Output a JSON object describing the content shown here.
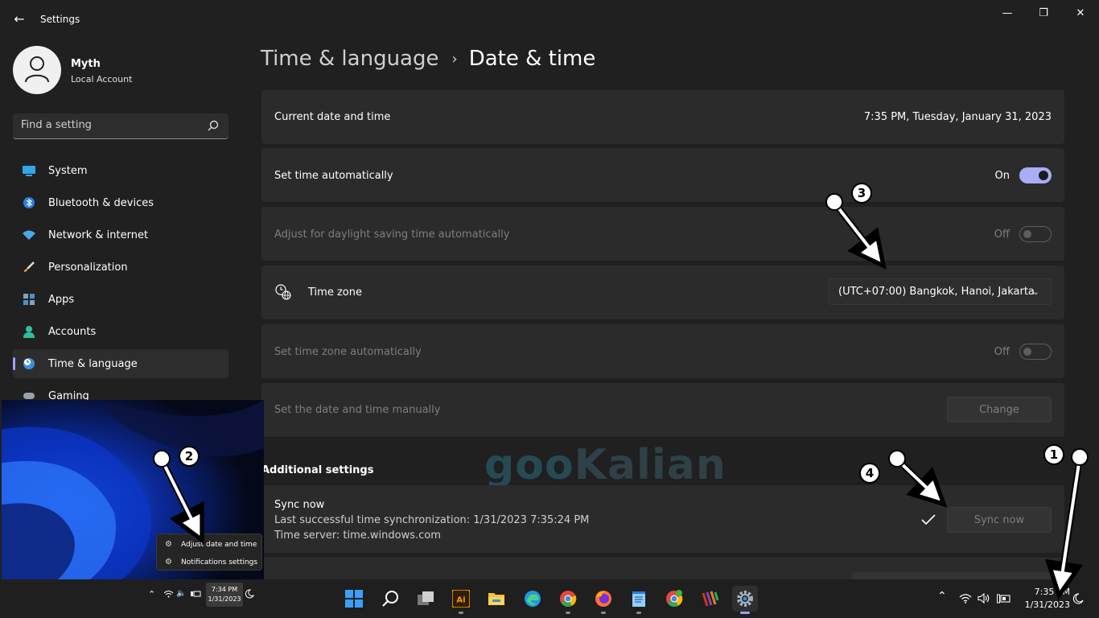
{
  "window": {
    "title": "Settings"
  },
  "profile": {
    "name": "Myth",
    "account_type": "Local Account"
  },
  "search": {
    "placeholder": "Find a setting"
  },
  "sidebar": {
    "items": [
      {
        "label": "System",
        "icon": "system-icon"
      },
      {
        "label": "Bluetooth & devices",
        "icon": "bluetooth-icon"
      },
      {
        "label": "Network & internet",
        "icon": "network-icon"
      },
      {
        "label": "Personalization",
        "icon": "brush-icon"
      },
      {
        "label": "Apps",
        "icon": "apps-icon"
      },
      {
        "label": "Accounts",
        "icon": "person-icon"
      },
      {
        "label": "Time & language",
        "icon": "clock-globe-icon",
        "active": true
      },
      {
        "label": "Gaming",
        "icon": "gamepad-icon"
      }
    ]
  },
  "breadcrumb": {
    "parent": "Time & language",
    "current": "Date & time"
  },
  "settings": {
    "current": {
      "label": "Current date and time",
      "value": "7:35 PM, Tuesday, January 31, 2023"
    },
    "auto_time": {
      "label": "Set time automatically",
      "state": "On"
    },
    "daylight": {
      "label": "Adjust for daylight saving time automatically",
      "state": "Off"
    },
    "timezone": {
      "label": "Time zone",
      "value": "(UTC+07:00) Bangkok, Hanoi, Jakarta"
    },
    "auto_zone": {
      "label": "Set time zone automatically",
      "state": "Off"
    },
    "manual": {
      "label": "Set the date and time manually",
      "button": "Change"
    }
  },
  "additional": {
    "title": "Additional settings",
    "sync": {
      "title": "Sync now",
      "last_sync": "Last successful time synchronization: 1/31/2023 7:35:24 PM",
      "server": "Time server: time.windows.com",
      "button": "Sync now"
    }
  },
  "watermark": {
    "part1": "goo",
    "part2": "Kalian"
  },
  "inset": {
    "menu": {
      "item1": "Adjust date and time",
      "item2": "Notifications settings"
    },
    "clock": {
      "time": "7:34 PM",
      "date": "1/31/2023"
    }
  },
  "taskbar": {
    "apps": [
      "windows-start-icon",
      "search-icon",
      "task-view-icon",
      "illustrator-icon",
      "file-explorer-icon",
      "edge-icon",
      "chrome-icon",
      "firefox-icon",
      "notepad-icon",
      "chrome-icon",
      "winrar-icon",
      "settings-gear-icon"
    ],
    "illustrator_label": "Ai",
    "clock": {
      "time": "7:35 PM",
      "date": "1/31/2023"
    }
  },
  "annotations": {
    "n1": "1",
    "n2": "2",
    "n3": "3",
    "n4": "4"
  },
  "colors": {
    "accent": "#a9adf6",
    "background": "#202020",
    "card": "#2b2b2b"
  }
}
